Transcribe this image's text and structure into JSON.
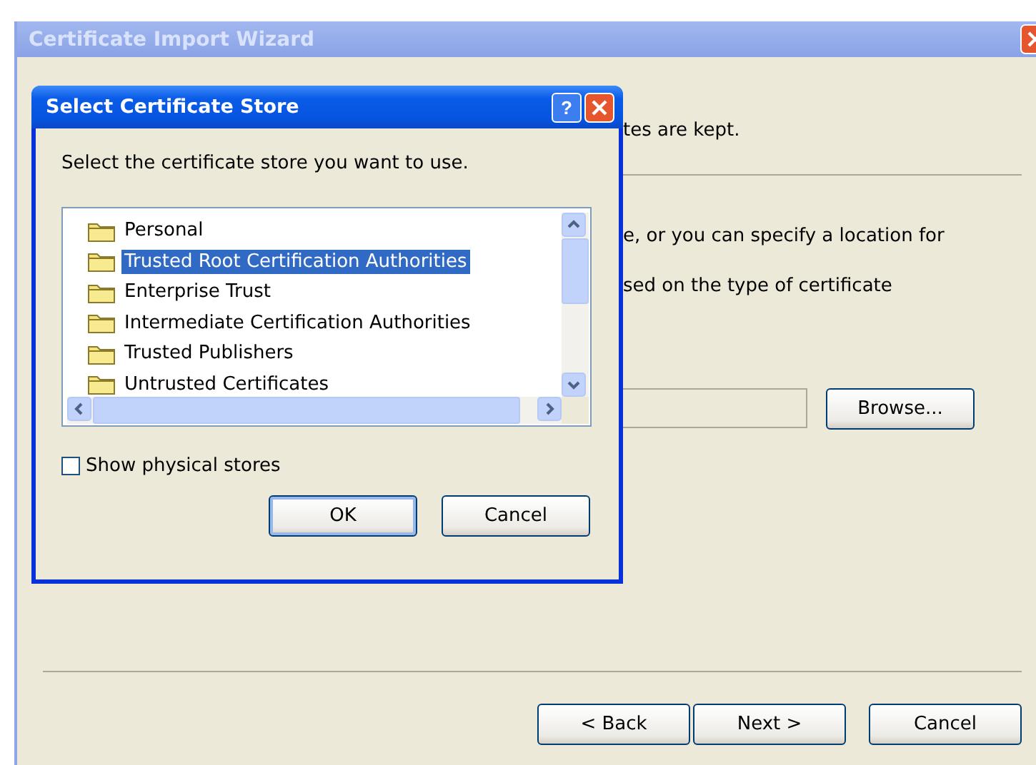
{
  "window": {
    "title": "Certificate Import Wizard",
    "texts": [
      "tes are kept.",
      "e, or you can specify a location for",
      "sed on the type of certificate"
    ],
    "browse_button": "Browse...",
    "buttons": [
      {
        "label": "< Back",
        "default": false
      },
      {
        "label": "Next >",
        "default": false
      },
      {
        "label": "Cancel",
        "default": false
      }
    ]
  },
  "dialog": {
    "title": "Select Certificate Store",
    "help": "?",
    "instruction": "Select the certificate store you want to use.",
    "stores": [
      {
        "label": "Personal",
        "selected": false
      },
      {
        "label": "Trusted Root Certification Authorities",
        "selected": true
      },
      {
        "label": "Enterprise Trust",
        "selected": false
      },
      {
        "label": "Intermediate Certification Authorities",
        "selected": false
      },
      {
        "label": "Trusted Publishers",
        "selected": false
      },
      {
        "label": "Untrusted Certificates",
        "selected": false
      }
    ],
    "show_physical_stores": {
      "label": "Show physical stores",
      "checked": false
    },
    "buttons": [
      {
        "label": "OK",
        "default": true
      },
      {
        "label": "Cancel",
        "default": false
      }
    ]
  }
}
